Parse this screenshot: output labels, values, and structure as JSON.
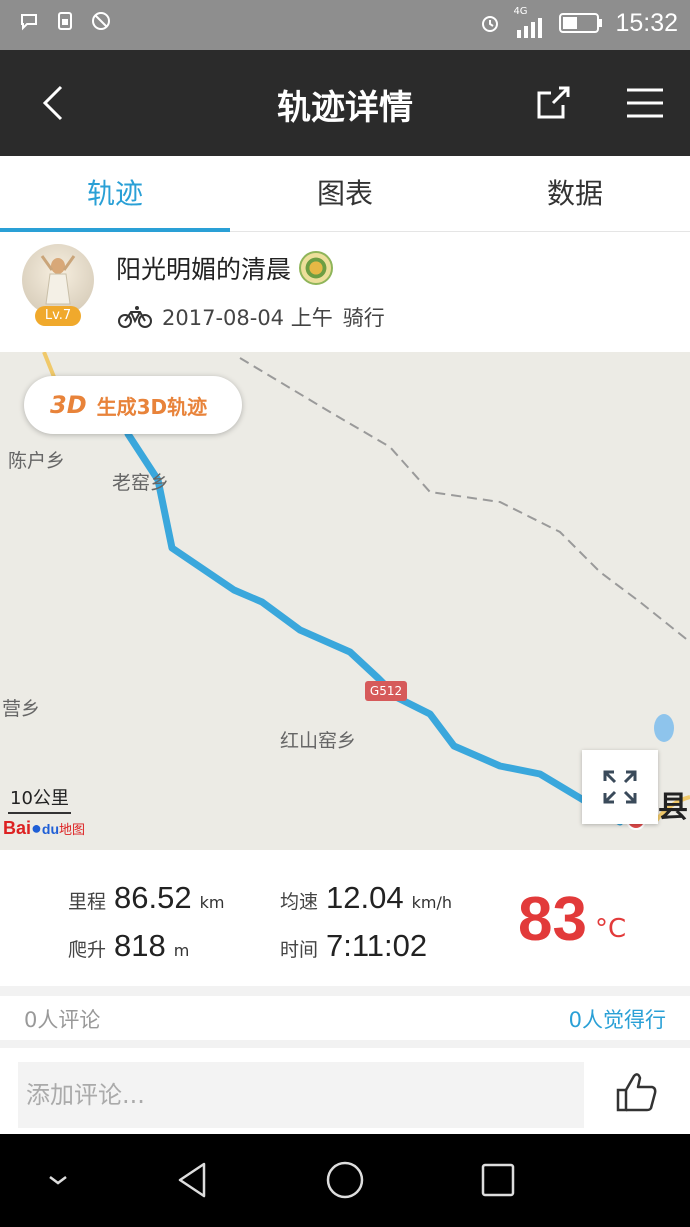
{
  "status_bar": {
    "time": "15:32",
    "network": "4G",
    "icons": [
      "chat-bubble-icon",
      "sim-card-icon",
      "blocked-icon",
      "alarm-icon",
      "signal-icon",
      "battery-icon"
    ]
  },
  "header": {
    "title": "轨迹详情",
    "icons": [
      "back-icon",
      "share-icon",
      "menu-icon"
    ]
  },
  "tabs": [
    {
      "label": "轨迹",
      "active": true
    },
    {
      "label": "图表",
      "active": false
    },
    {
      "label": "数据",
      "active": false
    }
  ],
  "user": {
    "name": "阳光明媚的清晨",
    "level": "Lv.7",
    "date": "2017-08-04 上午",
    "activity": "骑行"
  },
  "map": {
    "button_3d_icon_text": "3D",
    "button_3d_label": "生成3D轨迹",
    "places": [
      "陈户乡",
      "老窑乡",
      "营乡",
      "红山窑乡"
    ],
    "road_sign": "G512",
    "county_char": "县",
    "scale": "10公里",
    "logo_text": "Bai",
    "logo_du": "du",
    "logo_suffix": "地图"
  },
  "stats": {
    "distance_label": "里程",
    "distance": "86.52",
    "distance_unit": "km",
    "speed_label": "均速",
    "speed": "12.04",
    "speed_unit": "km/h",
    "climb_label": "爬升",
    "climb": "818",
    "climb_unit": "m",
    "time_label": "时间",
    "time": "7:11:02",
    "temperature": "83",
    "temperature_unit": "°C"
  },
  "social": {
    "comments": "0人评论",
    "likes": "0人觉得行",
    "comment_placeholder": "添加评论..."
  },
  "colors": {
    "accent": "#2aa0d6",
    "route": "#3aa7dc",
    "temperature": "#e23a3a",
    "header": "#2b2b2b"
  }
}
